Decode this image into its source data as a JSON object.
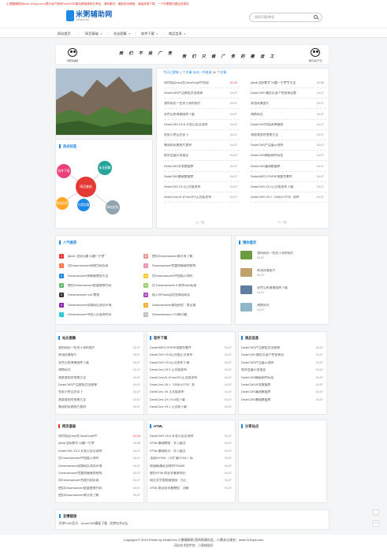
{
  "notice": "小提醒辅助网www.119zyw.com提示用户拥有DedeCMS建站教程源码共享站，源码素材，最新技术教程，海量资源下载，一个你需要的建站资源站",
  "logo": {
    "name": "米粥辅助网",
    "sub": "119zyw.com"
  },
  "search": {
    "placeholder": "搜索问题/教程"
  },
  "nav": [
    {
      "label": "网站首页",
      "dd": false
    },
    {
      "label": "网页基础",
      "dd": true
    },
    {
      "label": "站长图集",
      "dd": true
    },
    {
      "label": "软件下载",
      "dd": true
    },
    {
      "label": "商品信息",
      "dd": true
    }
  ],
  "banner": {
    "left_caption": "你要加油哦",
    "slogan1": "我 们 不 投 广 告",
    "slogan2": "我 们 只 做 广 告 的 搬 运 工",
    "right_caption": "我们好好干活"
  },
  "today": {
    "label": "今日已更新",
    "count": "1",
    "mid": "个文章 本站一共收录",
    "total": "99",
    "unit": "个文章"
  },
  "list_left": [
    {
      "t": "如何用jQuery在JavaScript中实现",
      "d": "02-26",
      "red": true
    },
    {
      "t": "DedeCMS产品按钮点击效果",
      "d": "04-07"
    },
    {
      "t": "我的网页一些关于说的照片",
      "d": "04-07"
    },
    {
      "t": "宣传山的海景图库下载",
      "d": "04-07"
    },
    {
      "t": "DedeCMS V5.6 开发日志及说明",
      "d": "04-07"
    },
    {
      "t": "农家小院山庄家下",
      "d": "04-07"
    },
    {
      "t": "美丽的风景照片素材",
      "d": "04-07"
    },
    {
      "t": "程序会展开发报告",
      "d": "04-07"
    },
    {
      "t": "DedeCMS开发数据库",
      "d": "04-07"
    },
    {
      "t": "DedeCMS基础数据库",
      "d": "04-07"
    },
    {
      "t": "DedeCMS V5.3正式版发布",
      "d": "04-07"
    },
    {
      "t": "DedeCmsV5.1FreeSP1正式版发布",
      "d": "04-07"
    }
  ],
  "list_right": [
    {
      "t": "jdedir活跃数字 乐趣一手梦字大全",
      "d": "04-08"
    },
    {
      "t": "DedeCMS 最优页面个性安装设置",
      "d": "04-07"
    },
    {
      "t": "原油风景图片",
      "d": "04-07"
    },
    {
      "t": "海南风光",
      "d": "04-07"
    },
    {
      "t": "DedeCMS内容表单截图",
      "d": "04-07"
    },
    {
      "t": "海浪浪花的雪景大全",
      "d": "04-07"
    },
    {
      "t": "DedeCMS产品展示说明",
      "d": "04-07"
    },
    {
      "t": "DedeCMS模板制作标签",
      "d": "04-07"
    },
    {
      "t": "DedeCMS漏洞数据库",
      "d": "04-07"
    },
    {
      "t": "DedeAMPZ-PHP环境整合套件",
      "d": "04-07"
    },
    {
      "t": "DedeCMS V5.1正式版发布下载",
      "d": "04-07"
    },
    {
      "t": "DedeCMS V5.1（GBK/UTF8）发布",
      "d": "04-07"
    }
  ],
  "pager": {
    "prev": "上一页",
    "next": "下一页"
  },
  "tags": {
    "title": "热点标签",
    "center": "网页基础",
    "items": [
      "软件下载",
      "站长图集",
      "商品信息",
      "分类加载",
      "网站优化",
      "关注CMS"
    ]
  },
  "ranking": {
    "title": "人气推荐",
    "items": [
      {
        "n": "1",
        "t": "jdedir 活跃乐趣 乐趣一手梦"
      },
      {
        "n": "2",
        "t": "用Dreamweaver创建为网页表"
      },
      {
        "n": "3",
        "t": "Dreamweaver快捷键使用大全"
      },
      {
        "n": "4",
        "t": "使用Dreamweaver批量替换代码"
      },
      {
        "n": "5",
        "t": "Dreamweaver cs3 教程"
      },
      {
        "n": "6",
        "t": "Dreamweaver局域网页测试环境"
      },
      {
        "n": "7",
        "t": "Dreamweaver中加入页面的时间"
      },
      {
        "n": "8",
        "t": "使用Dreamweaver来开发了解"
      },
      {
        "n": "9",
        "t": "Dreamweaver完整快捷键的结构"
      },
      {
        "n": "10",
        "t": "在Dreamweaver中加插入的时"
      },
      {
        "n": "11",
        "t": "用 Dreamweaver 8 制作web标准"
      },
      {
        "n": "12",
        "t": "插入对Flash层信息体现网页"
      },
      {
        "n": "13",
        "t": "Dreamweaver建站经验：常见操"
      },
      {
        "n": "14",
        "t": "Dreamweaver CS3新功能"
      }
    ]
  },
  "pics": {
    "title": "猜你喜欢",
    "items": [
      {
        "t": "我的网页一些关于说的照片",
        "d": "04-07"
      },
      {
        "t": "原油风景图片",
        "d": "04-07"
      },
      {
        "t": "宣传山的海景图库下载",
        "d": "04-07"
      },
      {
        "t": "海南风光",
        "d": "04-07"
      }
    ]
  },
  "boxes": [
    {
      "title": "站长图集",
      "rows": [
        [
          "我的网页一些关于说的照片",
          "04-07"
        ],
        [
          "原油风景图片",
          "04-07"
        ],
        [
          "宣传山的海景图库下载",
          "04-07"
        ],
        [
          "海南风光",
          "04-07"
        ],
        [
          "海浪浪花的雪景大全",
          "04-07"
        ],
        [
          "DedeCMS产品按钮点击效果",
          "04-07"
        ],
        [
          "农家小院山庄家下",
          "04-07"
        ],
        [
          "海浪浪花的雪景大全",
          "04-07"
        ],
        [
          "美丽的风景照片素材",
          "04-07"
        ]
      ]
    },
    {
      "title": "软件下载",
      "rows": [
        [
          "DedeAMPZ-PHP环境整合套件",
          "04-07"
        ],
        [
          "DedeCMS V5.5正式版正式发布",
          "04-07"
        ],
        [
          "DedeCMS V5.3正式发布下载",
          "04-07"
        ],
        [
          "DedeCms V5.5 正式版发布",
          "04-07"
        ],
        [
          "DedeCmsV5.1FreeSP1正式版发布",
          "04-07"
        ],
        [
          "DedeCms V5.1（GBK/UTF8）发",
          "04-07"
        ],
        [
          "DedeCms V5 正式版发布",
          "04-07"
        ],
        [
          "DedeCms OX V4.0发下载",
          "04-07"
        ],
        [
          "DedeCms V3.1 正式版下载",
          "04-07"
        ]
      ]
    },
    {
      "title": "商品信息",
      "rows": [
        [
          "DedeCMS产品按钮点击效果",
          "04-07"
        ],
        [
          "DedeCMS 最优页面个性安装设",
          "04-07"
        ],
        [
          "DedeCMS产品展示说明",
          "04-07"
        ],
        [
          "程序会展开发报告",
          "04-07"
        ],
        [
          "DedeCMS模板制作标签",
          "04-07"
        ],
        [
          "DedeCMS开发数据库",
          "04-07"
        ],
        [
          "DedeCMS漏洞数据库",
          "04-07"
        ],
        [
          "DedeCMS基础数据库",
          "04-07"
        ]
      ]
    },
    {
      "title": "网页基础",
      "rows": [
        [
          "如何用jQuery在JavaScript中",
          "02-26"
        ],
        [
          "jdedir活跃数字 乐趣一手梦",
          "04-08"
        ],
        [
          "DedeCMS V5.6 开发日志及说明",
          "04-07"
        ],
        [
          "在Dreamweaver中加插入的时",
          "04-07"
        ],
        [
          "Dreamweaver局域网页测试环境",
          "04-07"
        ],
        [
          "Dreamweaver完整快捷键的结构",
          "04-07"
        ],
        [
          "用Dreamweaver合理为网页表",
          "04-07"
        ],
        [
          "使用Dreamweaver批量替换代码",
          "04-07"
        ],
        [
          "使用Dreamweaver来开发了解",
          "04-07"
        ]
      ]
    },
    {
      "title": "HTML",
      "rows": [
        [
          "DedeCMS V5.6 开发日志及说明",
          "04-07"
        ],
        [
          "HTML基础教程：学习要点",
          "04-07"
        ],
        [
          "HTML基础知识：学习要点",
          "04-07"
        ],
        [
          "浅谈XHTML（可扩展HTML）标",
          "04-07"
        ],
        [
          "快速精通网页制作FRAME",
          "04-07"
        ],
        [
          "使用HTML的初学者需知识",
          "04-07"
        ],
        [
          "网页文字加超级链接：为正",
          "04-07"
        ],
        [
          "HTML常见初学者教程：详解",
          "04-07"
        ]
      ]
    },
    {
      "title": "分享站点",
      "rows": []
    }
  ],
  "friends": {
    "title": "友情链接",
    "items": [
      "织梦CMS官方",
      "DedeCMS模板下载",
      "织梦技术论坛"
    ]
  },
  "footer": {
    "line1": "Copyright © 2019  Power by DedeCms   小黄辅助网-您的网源社区，小黄永久域名：www.119zyw.com",
    "line2": "网站技术提供商：小黄辅助网"
  }
}
